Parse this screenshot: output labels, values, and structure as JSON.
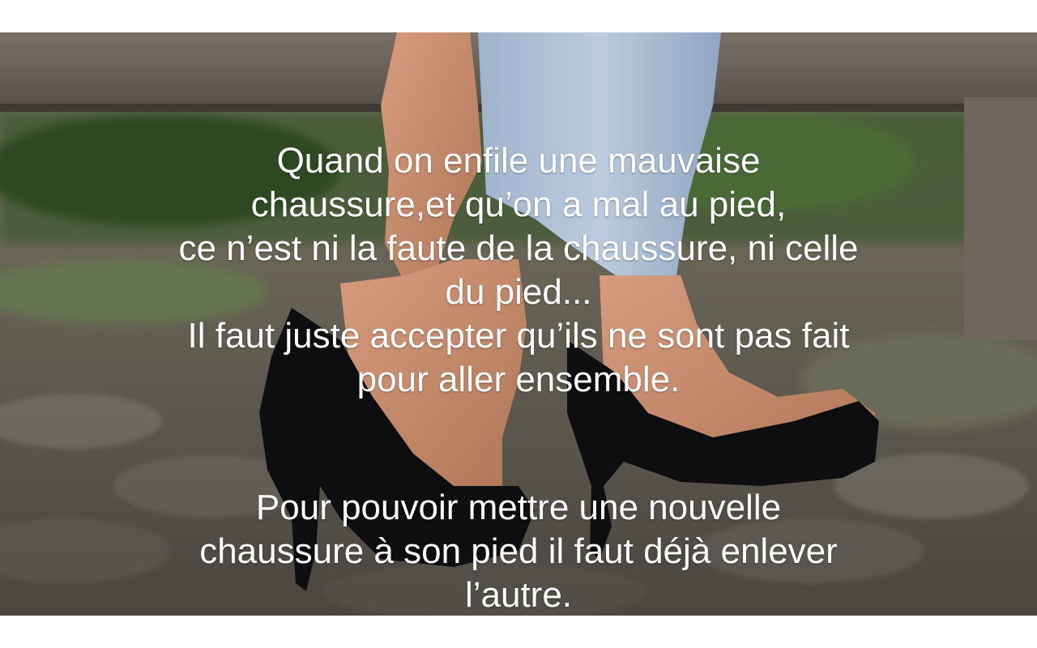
{
  "quote": {
    "paragraph1": [
      "Quand on enfile une mauvaise",
      "chaussure,et qu’on a mal au pied,",
      "ce n’est ni la faute de la chaussure, ni celle",
      "du pied...",
      "Il faut juste accepter qu’ils ne sont pas fait",
      "pour aller ensemble."
    ],
    "paragraph2": [
      "Pour pouvoir mettre une nouvelle",
      "chaussure à son pied il faut déjà enlever",
      "l’autre."
    ]
  },
  "colors": {
    "text": "#ffffff",
    "letterbox": "#ffffff",
    "shoe": "#0e0d10",
    "jeans": "#a9bdd4",
    "skin": "#c98f72",
    "bench": "#6a625a",
    "grass": "#4f6a3a"
  }
}
